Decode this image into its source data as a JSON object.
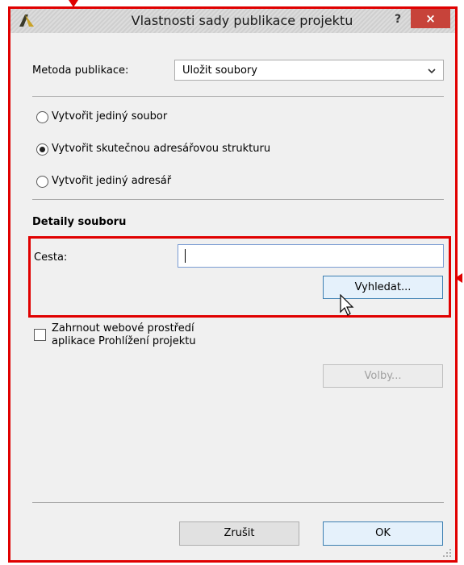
{
  "window": {
    "title": "Vlastnosti sady publikace projektu",
    "help_label": "?",
    "close_label": "×"
  },
  "publish_method": {
    "label": "Metoda publikace:",
    "selected": "Uložit soubory"
  },
  "options": [
    {
      "label": "Vytvořit jediný soubor",
      "selected": false
    },
    {
      "label": "Vytvořit skutečnou adresářovou strukturu",
      "selected": true
    },
    {
      "label": "Vytvořit jediný adresář",
      "selected": false
    }
  ],
  "file_details": {
    "heading": "Detaily souboru",
    "path_label": "Cesta:",
    "path_value": "",
    "browse_button": "Vyhledat..."
  },
  "web_env": {
    "checkbox_line1": "Zahrnout webové prostředí",
    "checkbox_line2": "aplikace Prohlížení projektu",
    "checked": false,
    "options_button": "Volby..."
  },
  "footer": {
    "cancel_button": "Zrušit",
    "ok_button": "OK"
  },
  "colors": {
    "annotation": "#e00000",
    "close_button": "#c7433a",
    "focus_border": "#3c7fb1"
  }
}
